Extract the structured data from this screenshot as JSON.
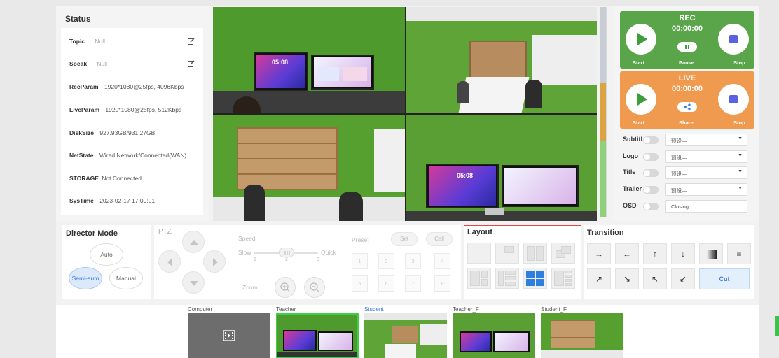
{
  "status": {
    "title": "Status",
    "rows": [
      {
        "key": "Topic",
        "value": "Null",
        "editable": true
      },
      {
        "key": "Speak",
        "value": "Null",
        "editable": true
      },
      {
        "key": "RecParam",
        "value": "1920*1080@25fps, 4096Kbps"
      },
      {
        "key": "LiveParam",
        "value": "1920*1080@25fps, 512Kbps"
      },
      {
        "key": "DiskSize",
        "value": "927.93GB/931.27GB"
      },
      {
        "key": "NetState",
        "value": "Wired Network/Connected(WAN)"
      },
      {
        "key": "STORAGE",
        "value": "Not Connected"
      },
      {
        "key": "SysTime",
        "value": "2023-02-17 17:09:01"
      }
    ]
  },
  "video": {
    "screen_time": "05:08"
  },
  "rec": {
    "title": "REC",
    "time": "00:00:00",
    "start": "Start",
    "pause": "Pause",
    "stop": "Stop",
    "color": "#5aa54a"
  },
  "live": {
    "title": "LIVE",
    "time": "00:00:00",
    "start": "Start",
    "share": "Share",
    "stop": "Stop",
    "color": "#f09a4f"
  },
  "overlays": [
    {
      "label": "Subtitl",
      "value": "预设—",
      "dropdown": true
    },
    {
      "label": "Logo",
      "value": "预设—",
      "dropdown": true
    },
    {
      "label": "Title",
      "value": "预设—",
      "dropdown": true
    },
    {
      "label": "Trailer",
      "value": "预设—",
      "dropdown": true
    },
    {
      "label": "OSD",
      "value": "Closing",
      "dropdown": false
    }
  ],
  "director": {
    "title": "Director Mode",
    "auto": "Auto",
    "semi": "Semi-auto",
    "manual": "Manual",
    "active": "Semi-auto"
  },
  "ptz": {
    "title": "PTZ",
    "speed": "Speed",
    "slow": "Slow",
    "quick": "Quick",
    "ticks": [
      "1",
      "2",
      "3"
    ],
    "zoom": "Zoom",
    "preset": "Preset",
    "set": "Set",
    "call": "Call",
    "presets": [
      "1",
      "2",
      "3",
      "4",
      "5",
      "6",
      "7",
      "8"
    ]
  },
  "layout": {
    "title": "Layout",
    "active_index": 6,
    "highlight_color": "#e04848"
  },
  "transition": {
    "title": "Transition",
    "cut": "Cut"
  },
  "sources": [
    {
      "label": "Computer",
      "active": false,
      "selected_label": false
    },
    {
      "label": "Teacher",
      "active": true,
      "selected_label": false
    },
    {
      "label": "Student",
      "active": false,
      "selected_label": true
    },
    {
      "label": "Teacher_F",
      "active": false,
      "selected_label": false
    },
    {
      "label": "Student_F",
      "active": false,
      "selected_label": false
    }
  ]
}
